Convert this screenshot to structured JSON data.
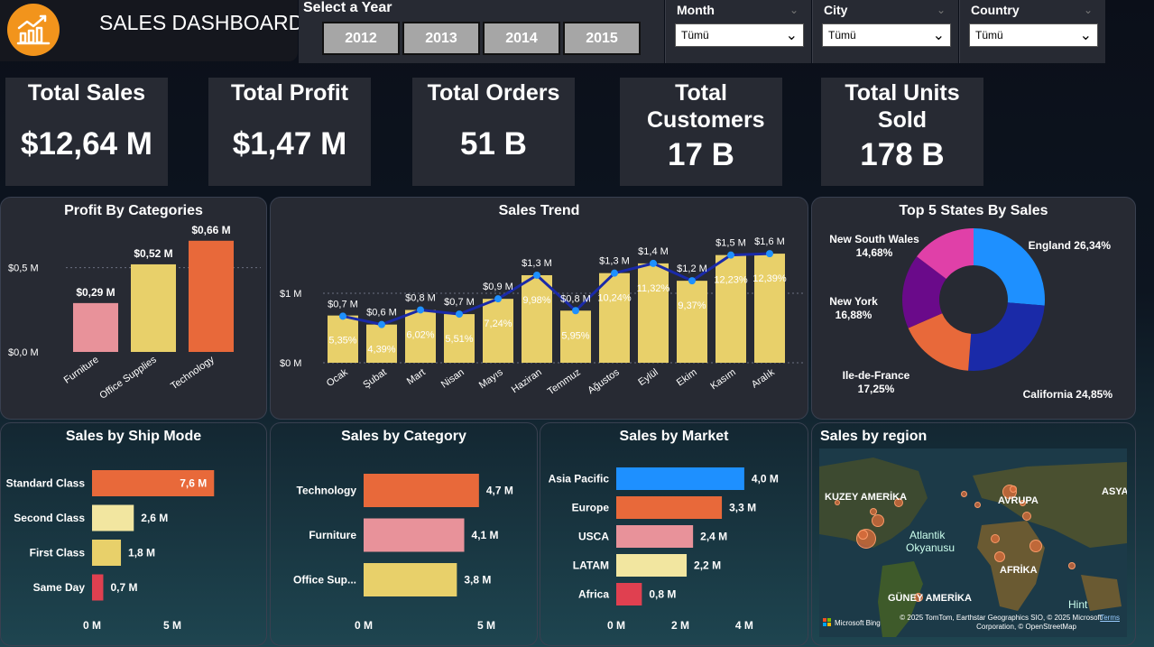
{
  "header": {
    "title": "SALES DASHBOARD",
    "logo_icon": "bar-chart-trend-icon"
  },
  "year_slicer": {
    "label": "Select a Year",
    "years": [
      "2012",
      "2013",
      "2014",
      "2015"
    ]
  },
  "filters": [
    {
      "label": "Month",
      "value": "Tümü"
    },
    {
      "label": "City",
      "value": "Tümü"
    },
    {
      "label": "Country",
      "value": "Tümü"
    }
  ],
  "kpis": [
    {
      "label": "Total Sales",
      "value": "$12,64 M"
    },
    {
      "label": "Total Profit",
      "value": "$1,47 M"
    },
    {
      "label": "Total Orders",
      "value": "51 B"
    },
    {
      "label": "Total Customers",
      "value": "17 B"
    },
    {
      "label": "Total Units Sold",
      "value": "178 B"
    }
  ],
  "chart_data": [
    {
      "title": "Profit By Categories",
      "type": "bar",
      "categories": [
        "Furniture",
        "Office Supplies",
        "Technology"
      ],
      "values": [
        0.29,
        0.52,
        0.66
      ],
      "labels": [
        "$0,29 M",
        "$0,52 M",
        "$0,66 M"
      ],
      "colors": [
        "#e8929a",
        "#e8d06a",
        "#e8693a"
      ],
      "yticks": [
        "$0,0 M",
        "$0,5 M"
      ],
      "ylim": [
        0,
        0.75
      ]
    },
    {
      "title": "Sales Trend",
      "type": "bar",
      "categories": [
        "Ocak",
        "Şubat",
        "Mart",
        "Nisan",
        "Mayıs",
        "Haziran",
        "Temmuz",
        "Ağustos",
        "Eylül",
        "Ekim",
        "Kasım",
        "Aralık"
      ],
      "values": [
        0.68,
        0.55,
        0.76,
        0.7,
        0.92,
        1.26,
        0.75,
        1.29,
        1.43,
        1.18,
        1.55,
        1.57
      ],
      "labels": [
        "$0,7 M",
        "$0,6 M",
        "$0,8 M",
        "$0,7 M",
        "$0,9 M",
        "$1,3 M",
        "$0,8 M",
        "$1,3 M",
        "$1,4 M",
        "$1,2 M",
        "$1,5 M",
        "$1,6 M"
      ],
      "shares": [
        "5,35%",
        "4,39%",
        "6,02%",
        "5,51%",
        "7,24%",
        "9,98%",
        "5,95%",
        "10,24%",
        "11,32%",
        "9,37%",
        "12,23%",
        "12,39%"
      ],
      "line_values": [
        0.67,
        0.55,
        0.76,
        0.7,
        0.92,
        1.26,
        0.75,
        1.29,
        1.43,
        1.18,
        1.55,
        1.57
      ],
      "yticks": [
        "$0 M",
        "$1 M"
      ],
      "ylim": [
        0,
        1.6
      ],
      "bar_color": "#e8d06a",
      "line_color": "#1a2aa8",
      "point_color": "#1e90ff"
    },
    {
      "title": "Top 5 States By Sales",
      "type": "pie",
      "categories": [
        "England",
        "California",
        "Ile-de-France",
        "New York",
        "New South Wales"
      ],
      "values": [
        26.34,
        24.85,
        17.25,
        16.88,
        14.68
      ],
      "labels": [
        "England 26,34%",
        "California 24,85%",
        "Ile-de-France 17,25%",
        "New York 16,88%",
        "New South Wales 14,68%"
      ],
      "colors": [
        "#1e90ff",
        "#1a2aa8",
        "#e8693a",
        "#6a0a8a",
        "#e040a8"
      ]
    },
    {
      "title": "Sales by Ship Mode",
      "type": "bar",
      "categories": [
        "Standard Class",
        "Second Class",
        "First Class",
        "Same Day"
      ],
      "values": [
        7.6,
        2.6,
        1.8,
        0.7
      ],
      "labels": [
        "7,6 M",
        "2,6 M",
        "1,8 M",
        "0,7 M"
      ],
      "colors": [
        "#e8693a",
        "#f2e6a0",
        "#e8d06a",
        "#e04050"
      ],
      "xticks": [
        "0 M",
        "5 M"
      ],
      "xlim": [
        0,
        10
      ]
    },
    {
      "title": "Sales by Category",
      "type": "bar",
      "categories": [
        "Technology",
        "Furniture",
        "Office Sup..."
      ],
      "values": [
        4.7,
        4.1,
        3.8
      ],
      "labels": [
        "4,7 M",
        "4,1 M",
        "3,8 M"
      ],
      "colors": [
        "#e8693a",
        "#e8929a",
        "#e8d06a"
      ],
      "xticks": [
        "0 M",
        "5 M"
      ],
      "xlim": [
        0,
        5
      ]
    },
    {
      "title": "Sales by Market",
      "type": "bar",
      "categories": [
        "Asia Pacific",
        "Europe",
        "USCA",
        "LATAM",
        "Africa"
      ],
      "values": [
        4.0,
        3.3,
        2.4,
        2.2,
        0.8
      ],
      "labels": [
        "4,0 M",
        "3,3 M",
        "2,4 M",
        "2,2 M",
        "0,8 M"
      ],
      "colors": [
        "#1e90ff",
        "#e8693a",
        "#e8929a",
        "#f2e6a0",
        "#e04050"
      ],
      "xticks": [
        "0 M",
        "2 M",
        "4 M"
      ],
      "xlim": [
        0,
        4.2
      ]
    }
  ],
  "map": {
    "title": "Sales by region",
    "labels": [
      "KUZEY AMERİKA",
      "AVRUPA",
      "ASYA",
      "Atlantik",
      "Okyanusu",
      "AFRİKA",
      "GÜNEY AMERİKA",
      "Hint"
    ],
    "attribution": "© 2025 TomTom, Earthstar Geographics SIO, © 2025 Microsoft",
    "attribution2": "Corporation, © OpenStreetMap",
    "terms": "Terms",
    "bing": "Microsoft Bing"
  }
}
